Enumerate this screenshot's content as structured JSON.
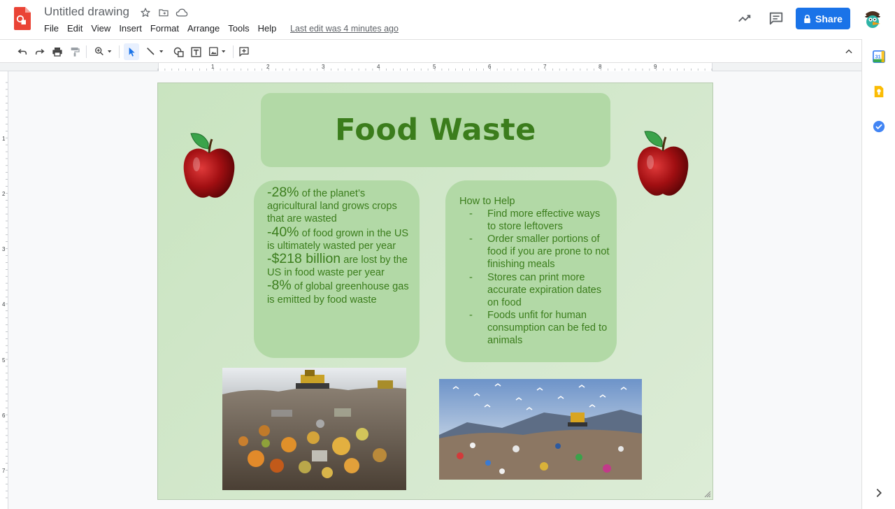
{
  "doc": {
    "title": "Untitled drawing",
    "last_edit": "Last edit was 4 minutes ago"
  },
  "menu": [
    "File",
    "Edit",
    "View",
    "Insert",
    "Format",
    "Arrange",
    "Tools",
    "Help"
  ],
  "share": {
    "label": "Share"
  },
  "toolbar": {
    "icons": [
      "undo-icon",
      "redo-icon",
      "print-icon",
      "paint-format-icon",
      "zoom-icon",
      "select-icon",
      "line-icon",
      "shape-icon",
      "text-box-icon",
      "image-icon",
      "comment-icon",
      "collapse-icon"
    ]
  },
  "side_panel": {
    "icons": [
      "calendar-icon",
      "keep-icon",
      "tasks-icon",
      "expand-panel-icon"
    ],
    "calendar_day": "31"
  },
  "ruler": {
    "horizontal": [
      "1",
      "2",
      "3",
      "4",
      "5",
      "6",
      "7",
      "8",
      "9"
    ],
    "vertical": [
      "1",
      "2",
      "3",
      "4",
      "5",
      "6",
      "7"
    ]
  },
  "drawing": {
    "title": "Food Waste",
    "stats": [
      {
        "big": "-28%",
        "text": " of the planet’s agricultural land grows crops that are wasted"
      },
      {
        "big": "-40%",
        "text": " of food grown in the US is ultimately wasted per year"
      },
      {
        "big": "-$218 billion",
        "text": " are lost by the US in food waste per year"
      },
      {
        "big": "-8%",
        "text": " of global greenhouse gas is emitted by food waste"
      }
    ],
    "help": {
      "heading": "How to Help",
      "items": [
        "Find more effective ways to store leftovers",
        "Order smaller portions of food if you are prone to not finishing meals",
        "Stores can print more accurate expiration dates on food",
        "Foods unfit for human consumption can be fed to animals"
      ],
      "bullet": "-"
    }
  },
  "colors": {
    "accent": "#1a73e8",
    "title_green": "#3b7d1c",
    "box_green": "#b2d9a6",
    "canvas_green": "#d4e8cd",
    "apple_red": "#b3161a"
  }
}
